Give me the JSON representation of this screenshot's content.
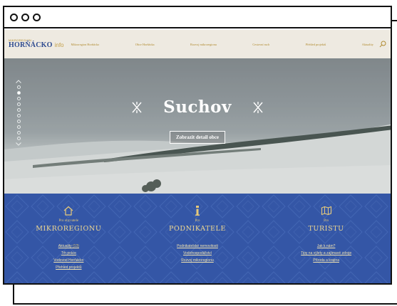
{
  "window": {
    "controls": [
      "circle",
      "circle",
      "circle"
    ]
  },
  "logo": {
    "top": "MIKROREGION",
    "name": "HORŇÁCKO",
    "suffix": "info"
  },
  "nav": {
    "items": [
      {
        "label": "Mikroregion Horňácko"
      },
      {
        "label": "Obce Horňácka"
      },
      {
        "label": "Rozvoj mikroregionu"
      },
      {
        "label": "Cestovní ruch"
      },
      {
        "label": "Přehled projektů"
      },
      {
        "label": "Aktuality"
      }
    ],
    "search_icon": "search-icon"
  },
  "hero": {
    "title": "Suchov",
    "button_label": "Zobrazit detail obce",
    "slides": {
      "count": 10,
      "active_index": 1
    }
  },
  "sections": [
    {
      "icon": "house-icon",
      "pre": "Pro obyvatele",
      "heading": "MIKROREGIONU",
      "links": [
        {
          "label": "Aktuality",
          "count": "(13)"
        },
        {
          "label": "Trh práce"
        },
        {
          "label": "Vodovod Horňácko"
        },
        {
          "label": "Přehled projektů"
        }
      ]
    },
    {
      "icon": "info-icon",
      "pre": "Pro",
      "heading": "PODNIKATELE",
      "links": [
        {
          "label": "Podnikatelské nemovitosti"
        },
        {
          "label": "Vodohospodářství"
        },
        {
          "label": "Rozvoj mikroregionu"
        }
      ]
    },
    {
      "icon": "map-icon",
      "pre": "Pro",
      "heading": "TURISTU",
      "links": [
        {
          "label": "Jak k nám?"
        },
        {
          "label": "Tipy na výlety a zajímavé zdroje"
        },
        {
          "label": "Příroda a krajina"
        }
      ]
    }
  ],
  "colors": {
    "brand_blue": "#3456a6",
    "gold": "#b08a2e",
    "nav_bg": "#eeeae1"
  }
}
